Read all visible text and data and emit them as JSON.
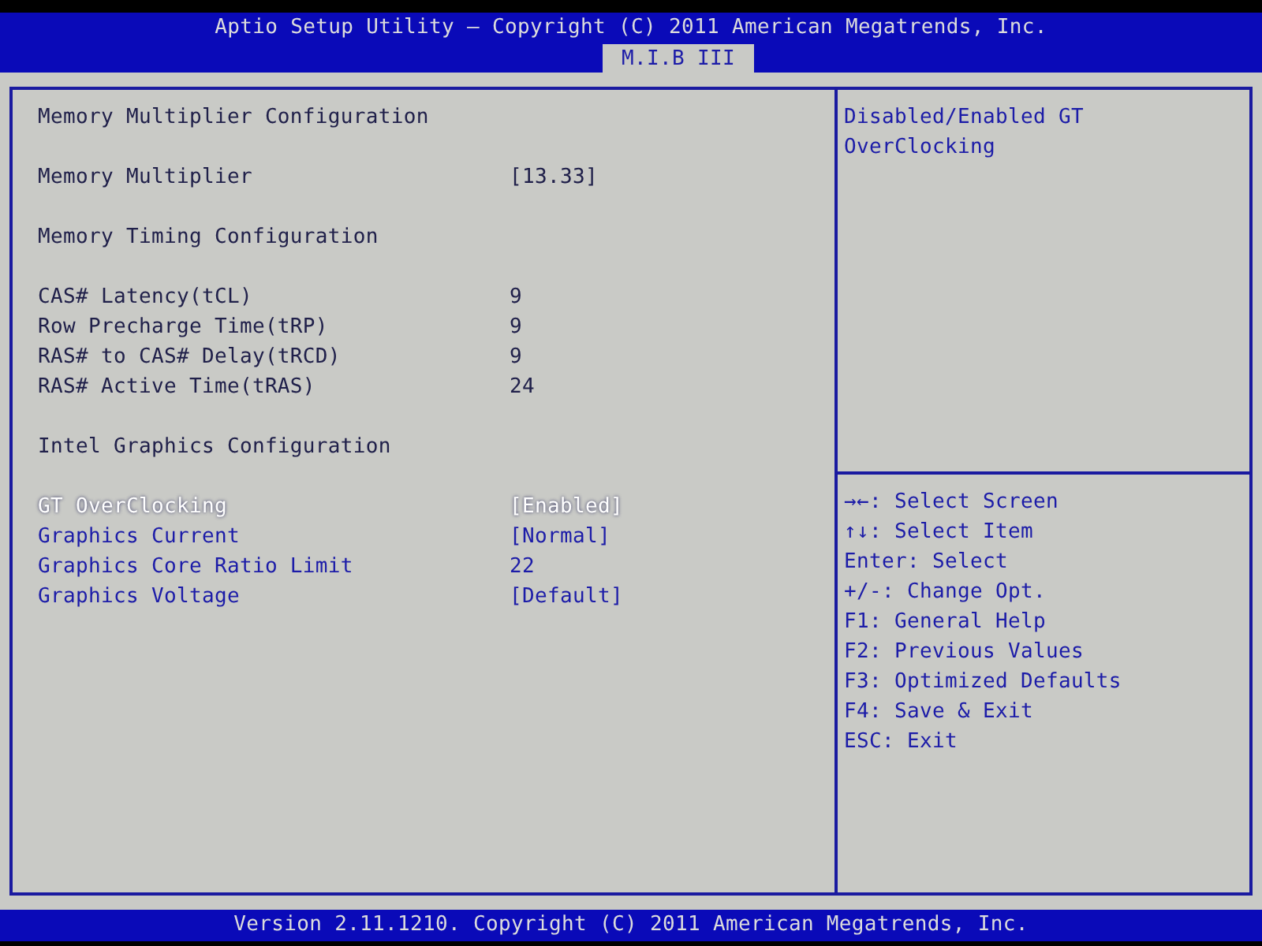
{
  "header": {
    "title": "Aptio Setup Utility – Copyright (C) 2011 American Megatrends, Inc.",
    "tabs": [
      {
        "label": "M.I.B III",
        "selected": true
      }
    ]
  },
  "sections": [
    {
      "title": "Memory Multiplier Configuration",
      "items": [
        {
          "kind": "info",
          "label": "Memory Multiplier",
          "value": "[13.33]",
          "selected": false
        }
      ]
    },
    {
      "title": "Memory Timing Configuration",
      "items": [
        {
          "kind": "info",
          "label": "CAS# Latency(tCL)",
          "value": "9",
          "selected": false
        },
        {
          "kind": "info",
          "label": "Row Precharge Time(tRP)",
          "value": "9",
          "selected": false
        },
        {
          "kind": "info",
          "label": "RAS# to CAS# Delay(tRCD)",
          "value": "9",
          "selected": false
        },
        {
          "kind": "info",
          "label": "RAS# Active Time(tRAS)",
          "value": "24",
          "selected": false
        }
      ]
    },
    {
      "title": "Intel Graphics Configuration",
      "items": [
        {
          "kind": "option",
          "label": "GT OverClocking",
          "value": "[Enabled]",
          "selected": true
        },
        {
          "kind": "option",
          "label": "Graphics Current",
          "value": "[Normal]",
          "selected": false
        },
        {
          "kind": "option",
          "label": "Graphics Core Ratio Limit",
          "value": "22",
          "selected": false
        },
        {
          "kind": "option",
          "label": "Graphics Voltage",
          "value": "[Default]",
          "selected": false
        }
      ]
    }
  ],
  "help": "Disabled/Enabled GT OverClocking",
  "keys": [
    "→←: Select Screen",
    "↑↓: Select Item",
    "Enter: Select",
    "+/-: Change Opt.",
    "F1: General Help",
    "F2: Previous Values",
    "F3: Optimized Defaults",
    "F4: Save & Exit",
    "ESC: Exit"
  ],
  "footer": "Version 2.11.1210. Copyright (C) 2011 American Megatrends, Inc."
}
